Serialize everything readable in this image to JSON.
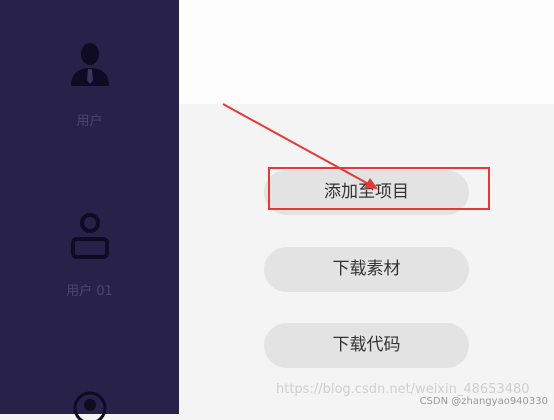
{
  "sidebar": {
    "items": [
      {
        "label": "用户",
        "icon": "user-tie-icon"
      },
      {
        "label": "用户 01",
        "icon": "user-outline-icon"
      },
      {
        "label": "",
        "icon": "avatar-icon"
      }
    ]
  },
  "actions": {
    "add_to_project": "添加至项目",
    "download_material": "下载素材",
    "download_code": "下载代码"
  },
  "watermark": {
    "url": "https://blog.csdn.net/weixin_48653480",
    "credit": "CSDN @zhangyao940330"
  },
  "colors": {
    "sidebar_bg": "#28214a",
    "sidebar_text": "#4b4670",
    "button_bg": "#e3e3e3",
    "annotation_red": "#e53935"
  }
}
